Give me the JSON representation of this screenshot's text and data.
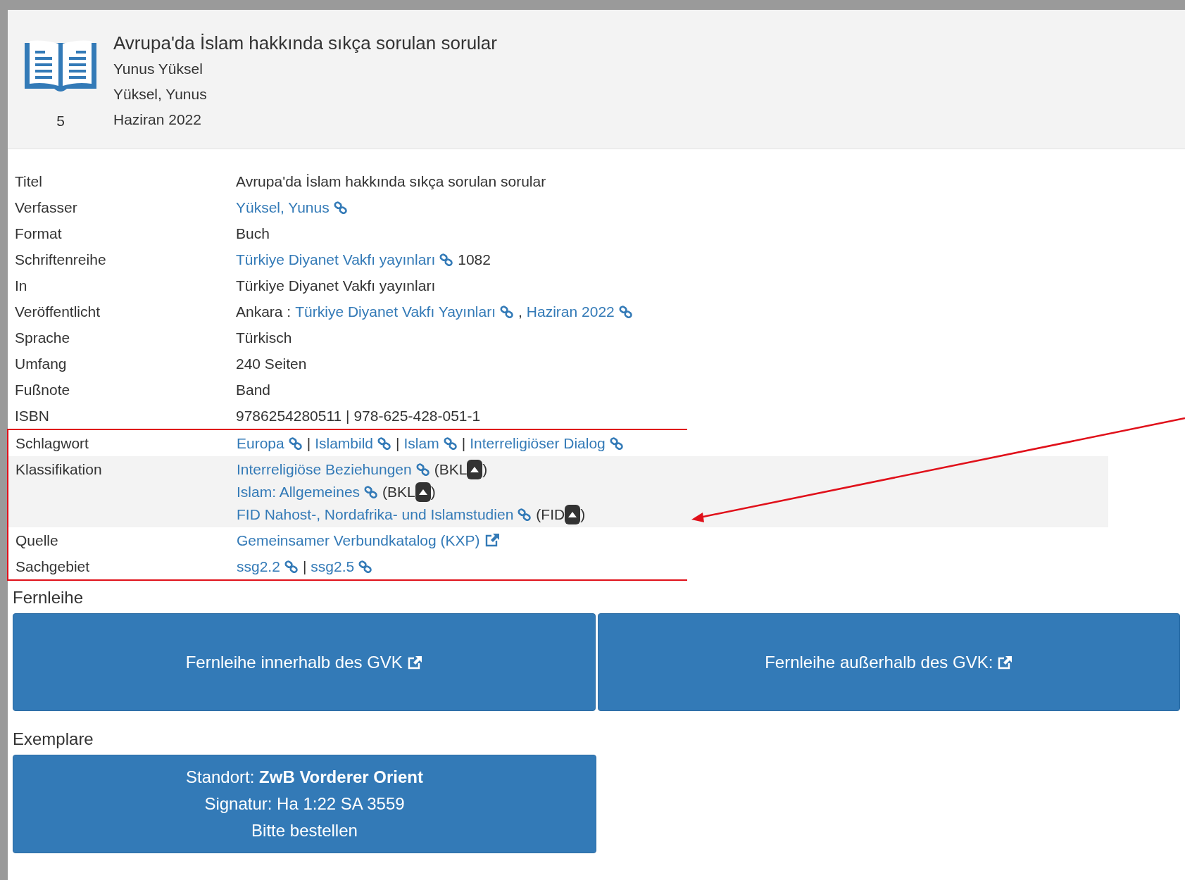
{
  "header": {
    "title": "Avrupa'da İslam hakkında sıkça sorulan sorular",
    "lines": [
      "Yunus Yüksel",
      "Yüksel, Yunus",
      "Haziran 2022"
    ],
    "count": "5"
  },
  "details": [
    {
      "label": "Titel",
      "highlighted": false,
      "marked": false,
      "lines": [
        [
          {
            "kind": "text",
            "text": "Avrupa'da İslam hakkında sıkça sorulan sorular"
          }
        ]
      ]
    },
    {
      "label": "Verfasser",
      "highlighted": false,
      "marked": false,
      "lines": [
        [
          {
            "kind": "link",
            "text": "Yüksel, Yunus"
          }
        ]
      ]
    },
    {
      "label": "Format",
      "highlighted": false,
      "marked": false,
      "lines": [
        [
          {
            "kind": "text",
            "text": "Buch"
          }
        ]
      ]
    },
    {
      "label": "Schriftenreihe",
      "highlighted": false,
      "marked": false,
      "lines": [
        [
          {
            "kind": "link",
            "text": "Türkiye Diyanet Vakfı yayınları"
          },
          {
            "kind": "text",
            "text": "1082"
          }
        ]
      ]
    },
    {
      "label": "In",
      "highlighted": false,
      "marked": false,
      "lines": [
        [
          {
            "kind": "text",
            "text": "Türkiye Diyanet Vakfı yayınları"
          }
        ]
      ]
    },
    {
      "label": "Veröffentlicht",
      "highlighted": false,
      "marked": false,
      "lines": [
        [
          {
            "kind": "text",
            "text": "Ankara :"
          },
          {
            "kind": "link",
            "text": "Türkiye Diyanet Vakfı Yayınları"
          },
          {
            "kind": "text",
            "text": ","
          },
          {
            "kind": "link",
            "text": "Haziran 2022"
          }
        ]
      ]
    },
    {
      "label": "Sprache",
      "highlighted": false,
      "marked": false,
      "lines": [
        [
          {
            "kind": "text",
            "text": "Türkisch"
          }
        ]
      ]
    },
    {
      "label": "Umfang",
      "highlighted": false,
      "marked": false,
      "lines": [
        [
          {
            "kind": "text",
            "text": "240 Seiten"
          }
        ]
      ]
    },
    {
      "label": "Fußnote",
      "highlighted": false,
      "marked": false,
      "lines": [
        [
          {
            "kind": "text",
            "text": "Band"
          }
        ]
      ]
    },
    {
      "label": "ISBN",
      "highlighted": false,
      "marked": false,
      "lines": [
        [
          {
            "kind": "text",
            "text": "9786254280511 | 978-625-428-051-1"
          }
        ]
      ]
    },
    {
      "label": "Schlagwort",
      "highlighted": false,
      "marked": true,
      "lines": [
        [
          {
            "kind": "link",
            "text": "Europa"
          },
          {
            "kind": "text",
            "text": "|"
          },
          {
            "kind": "link",
            "text": "Islambild"
          },
          {
            "kind": "text",
            "text": "|"
          },
          {
            "kind": "link",
            "text": "Islam"
          },
          {
            "kind": "text",
            "text": "|"
          },
          {
            "kind": "link",
            "text": "Interreligiöser Dialog"
          }
        ]
      ]
    },
    {
      "label": "Klassifikation",
      "highlighted": true,
      "marked": true,
      "lines": [
        [
          {
            "kind": "link",
            "text": "Interreligiöse Beziehungen"
          },
          {
            "kind": "text",
            "text": "(BKL"
          },
          {
            "kind": "toggle"
          },
          {
            "kind": "text",
            "text": ")"
          }
        ],
        [
          {
            "kind": "link",
            "text": "Islam: Allgemeines"
          },
          {
            "kind": "text",
            "text": "(BKL"
          },
          {
            "kind": "toggle"
          },
          {
            "kind": "text",
            "text": ")"
          }
        ],
        [
          {
            "kind": "link",
            "text": "FID Nahost-, Nordafrika- und Islamstudien"
          },
          {
            "kind": "text",
            "text": "(FID"
          },
          {
            "kind": "toggle"
          },
          {
            "kind": "text",
            "text": ")"
          }
        ]
      ]
    },
    {
      "label": "Quelle",
      "highlighted": false,
      "marked": true,
      "lines": [
        [
          {
            "kind": "extlink",
            "text": "Gemeinsamer Verbundkatalog (KXP)"
          }
        ]
      ]
    },
    {
      "label": "Sachgebiet",
      "highlighted": false,
      "marked": true,
      "lines": [
        [
          {
            "kind": "link",
            "text": "ssg2.2"
          },
          {
            "kind": "text",
            "text": "|"
          },
          {
            "kind": "link",
            "text": "ssg2.5"
          }
        ]
      ]
    }
  ],
  "fernleihe": {
    "heading": "Fernleihe",
    "buttons": [
      "Fernleihe innerhalb des GVK",
      "Fernleihe außerhalb des GVK:"
    ]
  },
  "exemplare": {
    "heading": "Exemplare",
    "lines": [
      "Standort: **ZwB Vorderer Orient**",
      "Signatur: Ha 1:22 SA 3559",
      "Bitte bestellen"
    ]
  }
}
